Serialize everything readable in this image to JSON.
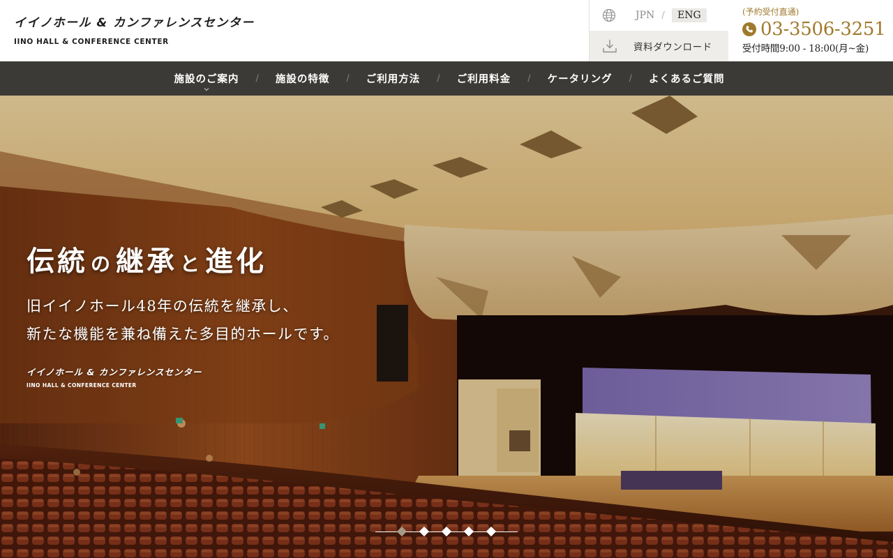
{
  "header": {
    "logo_ja": "イイノホール & カンファレンスセンター",
    "logo_en": "IINO HALL & CONFERENCE CENTER",
    "lang_jpn": "JPN",
    "lang_sep": "/",
    "lang_eng": "ENG",
    "download_label": "資料ダウンロード",
    "contact_note": "(予約受付直通)",
    "phone": "03-3506-3251",
    "hours": "受付時間9:00 - 18:00(月~金)",
    "accent_color": "#a07a2c"
  },
  "nav": {
    "items": [
      {
        "label": "施設のご案内",
        "icon": "chevron-down-icon"
      },
      {
        "label": "施設の特徴"
      },
      {
        "label": "ご利用方法"
      },
      {
        "label": "ご利用料金"
      },
      {
        "label": "ケータリング"
      },
      {
        "label": "よくあるご質問"
      }
    ],
    "separator": "/"
  },
  "hero": {
    "title_1": "伝統",
    "title_2": "の",
    "title_3": "継承",
    "title_4": "と",
    "title_5": "進化",
    "text_line1": "旧イイノホール48年の伝統を継承し、",
    "text_line2": "新たな機能を兼ね備えた多目的ホールです。",
    "logo_ja": "イイノホール & カンファレンスセンター",
    "logo_en": "IINO HALL & CONFERENCE CENTER",
    "slides_total": 5,
    "active_slide": 1
  }
}
